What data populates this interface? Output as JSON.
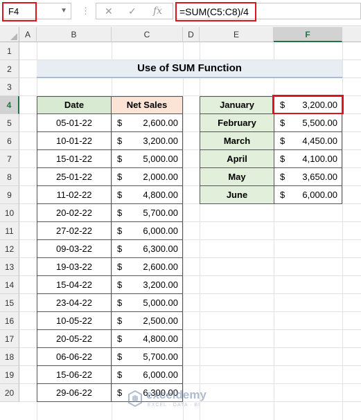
{
  "name_box": {
    "value": "F4"
  },
  "formula_bar": {
    "cancel_glyph": "✕",
    "enter_glyph": "✓",
    "fx_glyph": "fx",
    "formula": "=SUM(C5:C8)/4"
  },
  "columns": [
    "A",
    "B",
    "C",
    "D",
    "E",
    "F"
  ],
  "rows": [
    "1",
    "2",
    "3",
    "4",
    "5",
    "6",
    "7",
    "8",
    "9",
    "10",
    "11",
    "12",
    "13",
    "14",
    "15",
    "16",
    "17",
    "18",
    "19",
    "20"
  ],
  "selected_row": "4",
  "title": "Use of SUM Function",
  "sales_table": {
    "headers": {
      "date": "Date",
      "net_sales": "Net Sales"
    },
    "rows": [
      {
        "date": "05-01-22",
        "currency": "$",
        "amount": "2,600.00"
      },
      {
        "date": "10-01-22",
        "currency": "$",
        "amount": "3,200.00"
      },
      {
        "date": "15-01-22",
        "currency": "$",
        "amount": "5,000.00"
      },
      {
        "date": "25-01-22",
        "currency": "$",
        "amount": "2,000.00"
      },
      {
        "date": "11-02-22",
        "currency": "$",
        "amount": "4,800.00"
      },
      {
        "date": "20-02-22",
        "currency": "$",
        "amount": "5,700.00"
      },
      {
        "date": "27-02-22",
        "currency": "$",
        "amount": "6,000.00"
      },
      {
        "date": "09-03-22",
        "currency": "$",
        "amount": "6,300.00"
      },
      {
        "date": "19-03-22",
        "currency": "$",
        "amount": "2,600.00"
      },
      {
        "date": "15-04-22",
        "currency": "$",
        "amount": "3,200.00"
      },
      {
        "date": "23-04-22",
        "currency": "$",
        "amount": "5,000.00"
      },
      {
        "date": "10-05-22",
        "currency": "$",
        "amount": "2,500.00"
      },
      {
        "date": "20-05-22",
        "currency": "$",
        "amount": "4,800.00"
      },
      {
        "date": "06-06-22",
        "currency": "$",
        "amount": "5,700.00"
      },
      {
        "date": "15-06-22",
        "currency": "$",
        "amount": "6,000.00"
      },
      {
        "date": "29-06-22",
        "currency": "$",
        "amount": "6,300.00"
      }
    ]
  },
  "month_table": {
    "rows": [
      {
        "month": "January",
        "currency": "$",
        "amount": "3,200.00"
      },
      {
        "month": "February",
        "currency": "$",
        "amount": "5,500.00"
      },
      {
        "month": "March",
        "currency": "$",
        "amount": "4,450.00"
      },
      {
        "month": "April",
        "currency": "$",
        "amount": "4,100.00"
      },
      {
        "month": "May",
        "currency": "$",
        "amount": "3,650.00"
      },
      {
        "month": "June",
        "currency": "$",
        "amount": "6,000.00"
      }
    ]
  },
  "watermark": {
    "name": "exceldemy",
    "tagline": "EXCEL · DATA · BI"
  },
  "colors": {
    "highlight_red": "#e0121d",
    "header_green": "#d9ead3",
    "header_peach": "#fbe4d5",
    "month_green": "#e2efda"
  }
}
